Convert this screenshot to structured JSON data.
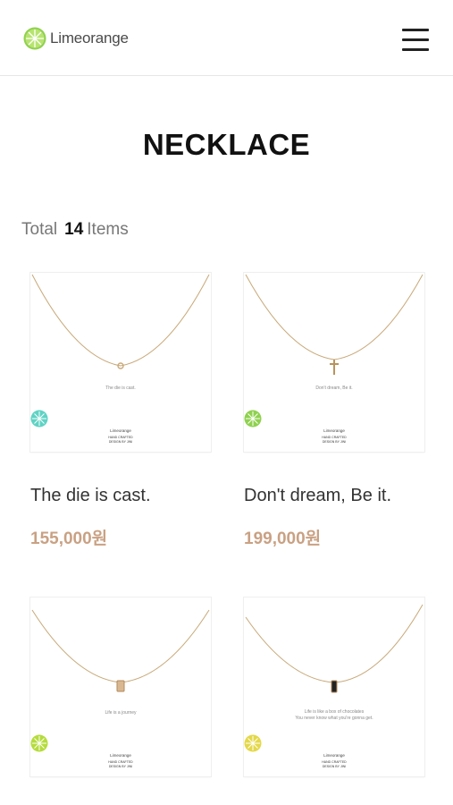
{
  "header": {
    "brand": "Limeorange",
    "logo_icon": "lime-slice-icon",
    "menu_icon": "hamburger-menu-icon"
  },
  "page": {
    "title": "NECKLACE"
  },
  "summary": {
    "total_label": "Total",
    "count": "14",
    "items_label": "Items"
  },
  "colors": {
    "price": "#c9a183",
    "lime_green": "#8fd14f",
    "lime_teal": "#5fd3c4",
    "lime_yellow": "#e4d84a"
  },
  "products": [
    {
      "name": "The die is cast.",
      "price": "155,000원",
      "card_caption": "The die is cast.",
      "card_brand": "Limeorange",
      "card_footer": "HAND CRAFTED\nDESIGN BY JINI",
      "logo_color": "#5fd3c4",
      "pendant": "ring"
    },
    {
      "name": "Don't dream, Be it.",
      "price": "199,000원",
      "card_caption": "Don't dream, Be it.",
      "card_brand": "Limeorange",
      "card_footer": "HAND CRAFTED\nDESIGN BY JINI",
      "logo_color": "#8fd14f",
      "pendant": "cross"
    },
    {
      "name": "",
      "price": "",
      "card_caption": "Life is a journey",
      "card_brand": "Limeorange",
      "card_footer": "HAND CRAFTED\nDESIGN BY JINI",
      "logo_color": "#b5dc3c",
      "pendant": "tag-gold"
    },
    {
      "name": "",
      "price": "",
      "card_caption": "Life is like a box of chocolates\nYou never know what you're gonna get.",
      "card_brand": "Limeorange",
      "card_footer": "HAND CRAFTED\nDESIGN BY JINI",
      "logo_color": "#e4d84a",
      "pendant": "tag-black"
    }
  ]
}
